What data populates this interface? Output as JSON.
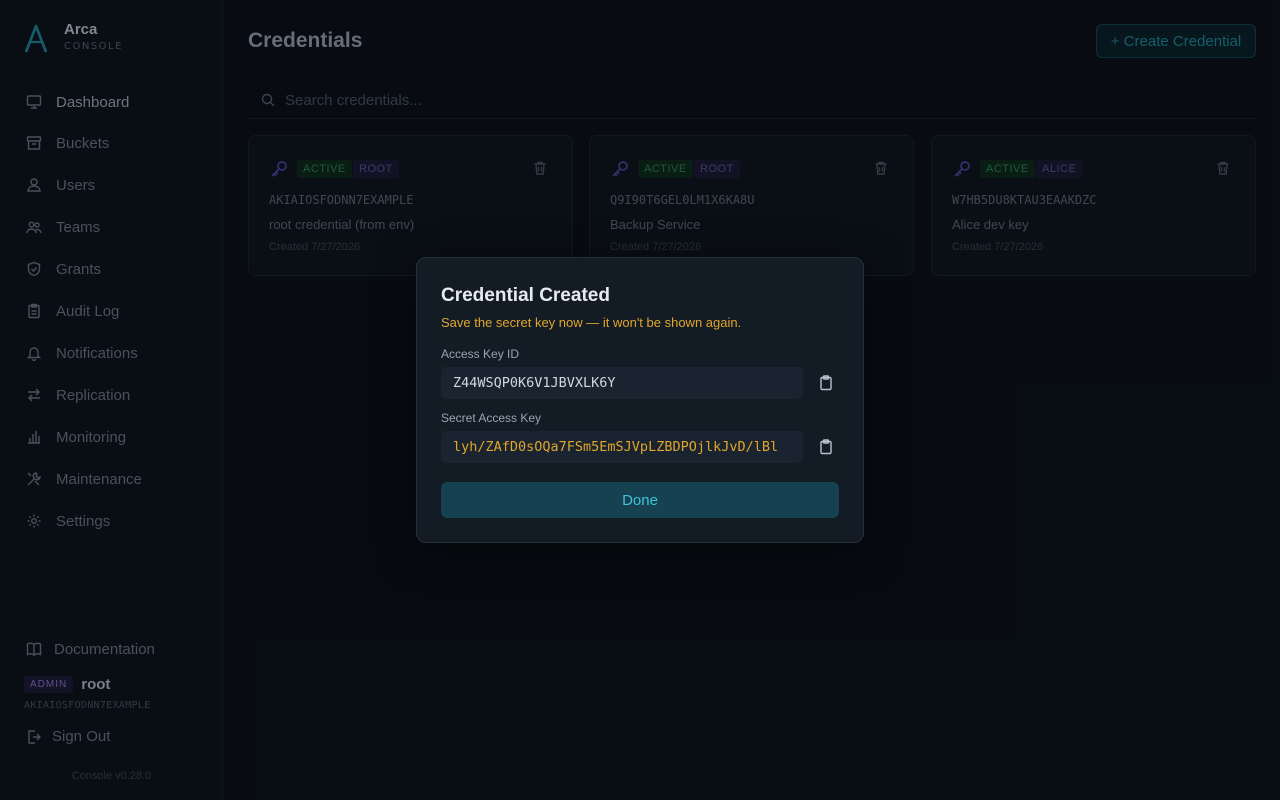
{
  "brand": {
    "name": "Arca",
    "sub": "CONSOLE",
    "accent": "#1e8ea0"
  },
  "sidebar": {
    "items": [
      {
        "label": "Dashboard",
        "icon": "monitor-icon"
      },
      {
        "label": "Buckets",
        "icon": "archive-icon"
      },
      {
        "label": "Users",
        "icon": "user-icon"
      },
      {
        "label": "Teams",
        "icon": "team-icon"
      },
      {
        "label": "Grants",
        "icon": "shield-icon"
      },
      {
        "label": "Audit Log",
        "icon": "clipboard-icon"
      },
      {
        "label": "Notifications",
        "icon": "bell-icon"
      },
      {
        "label": "Replication",
        "icon": "arrows-icon"
      },
      {
        "label": "Monitoring",
        "icon": "bar-chart-icon"
      },
      {
        "label": "Maintenance",
        "icon": "tools-icon"
      },
      {
        "label": "Settings",
        "icon": "gear-icon"
      }
    ],
    "docs_label": "Documentation",
    "user": {
      "badge": "ADMIN",
      "name": "root",
      "key": "AKIAIOSFODNN7EXAMPLE"
    },
    "signout_label": "Sign Out",
    "version": "Console v0.28.0"
  },
  "main": {
    "title": "Credentials",
    "create_label": "+ Create Credential",
    "search_placeholder": "Search credentials...",
    "cards": [
      {
        "status": "ACTIVE",
        "role": "ROOT",
        "key": "AKIAIOSFODNN7EXAMPLE",
        "desc": "root credential (from env)",
        "created": "Created 7/27/2026"
      },
      {
        "status": "ACTIVE",
        "role": "ROOT",
        "key": "Q9I90T6GEL0LM1X6KA8U",
        "desc": "Backup Service",
        "created": "Created 7/27/2026"
      },
      {
        "status": "ACTIVE",
        "role": "ALICE",
        "key": "W7HB5DU8KTAU3EAAKDZC",
        "desc": "Alice dev key",
        "created": "Created 7/27/2026"
      }
    ]
  },
  "modal": {
    "title": "Credential Created",
    "warning": "Save the secret key now — it won't be shown again.",
    "access_label": "Access Key ID",
    "access_value": "Z44WSQP0K6V1JBVXLK6Y",
    "secret_label": "Secret Access Key",
    "secret_value": "lyh/ZAfD0sOQa7FSm5EmSJVpLZBDPOjlkJvD/lBl",
    "done_label": "Done"
  }
}
